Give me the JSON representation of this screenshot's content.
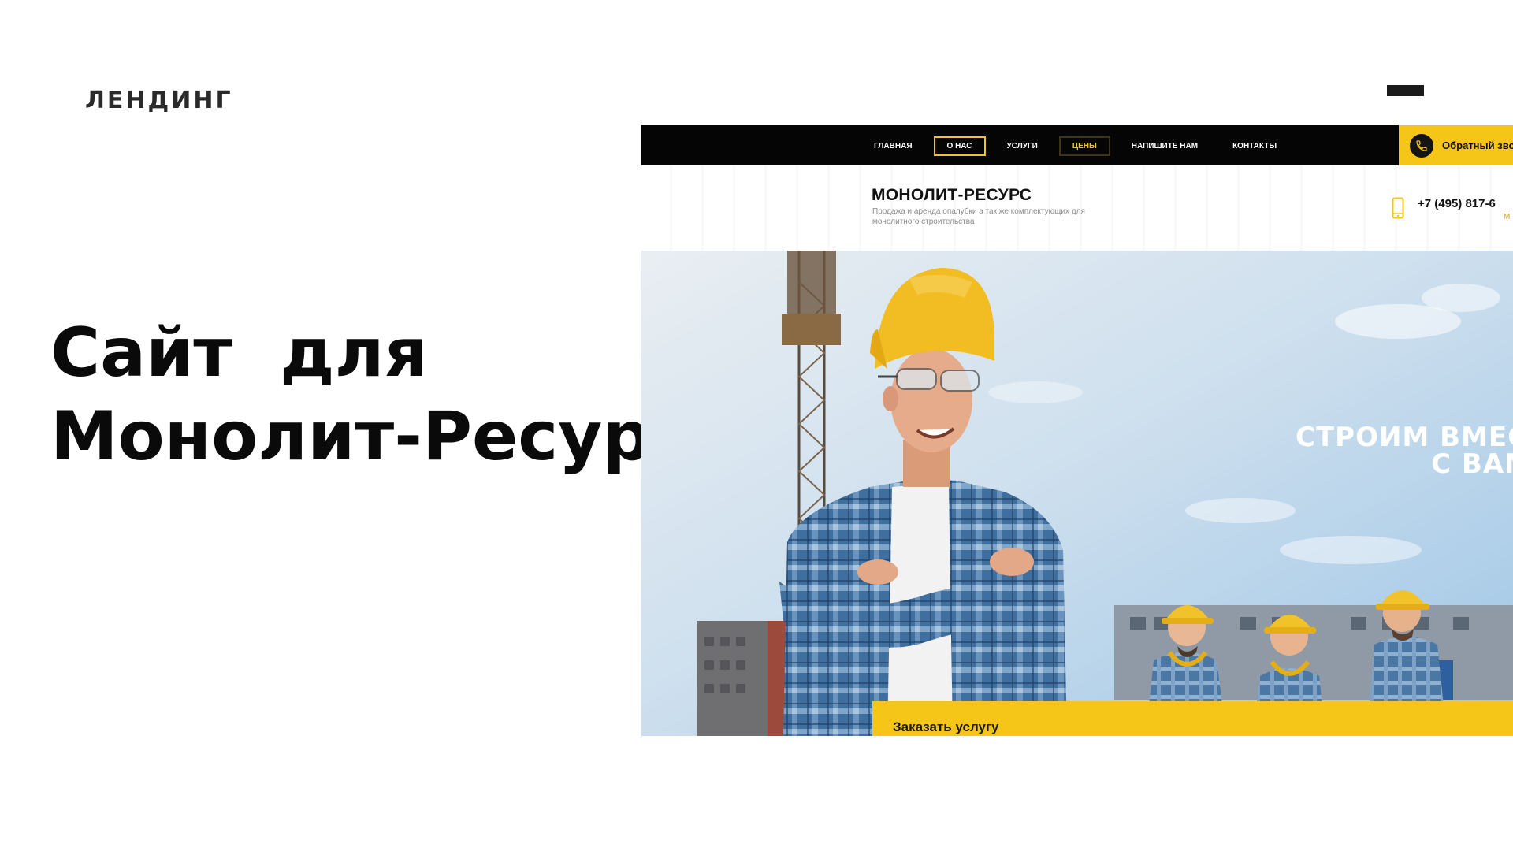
{
  "slide": {
    "eyebrow": "ЛЕНДИНГ",
    "title": "Сайт  для\nМонолит-Ресурс"
  },
  "site": {
    "nav": {
      "items": [
        {
          "label": "ГЛАВНАЯ",
          "style": "plain"
        },
        {
          "label": "О НАС",
          "style": "outlined"
        },
        {
          "label": "УСЛУГИ",
          "style": "plain"
        },
        {
          "label": "ЦЕНЫ",
          "style": "accent"
        },
        {
          "label": "НАПИШИТЕ НАМ",
          "style": "plain"
        },
        {
          "label": "КОНТАКТЫ",
          "style": "plain"
        }
      ],
      "callback_label": "Обратный звонок"
    },
    "brand": {
      "name": "МОНОЛИТ-РЕСУРС",
      "tagline": "Продажа и аренда опалубки а так же комплектующих для монолитного строительства",
      "phone": "+7 (495) 817-6",
      "phone_sub": "М"
    },
    "hero": {
      "slogan": "СТРОИМ ВМЕСТ\nС ВАМ",
      "order_label": "Заказать услугу"
    },
    "colors": {
      "accent": "#f5c518",
      "nav_bg": "#050505",
      "sky": "#b9d6ec"
    }
  }
}
